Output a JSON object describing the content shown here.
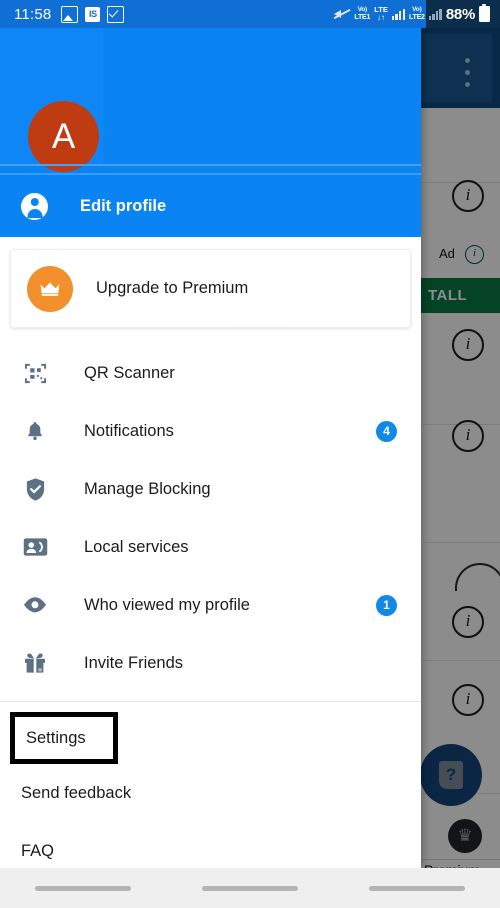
{
  "statusbar": {
    "time": "11:58",
    "left_icons": [
      "photo-icon",
      "is-badge-icon",
      "checkbox-icon"
    ],
    "is_badge_text": "IS",
    "mute_icon": "volume-mute-icon",
    "sim1": {
      "volte": "Vo)",
      "volte_sub": "LTE1",
      "tech": "LTE",
      "arrows": "↓↑"
    },
    "sim2": {
      "volte": "Vo)",
      "volte_sub": "LTE2"
    },
    "battery_text": "88%",
    "battery_icon": "battery-full-icon"
  },
  "drawer": {
    "avatar_initial": "A",
    "avatar_color": "#bf3c12",
    "header_color": "#0b84f3",
    "edit_profile": {
      "label": "Edit profile",
      "icon": "account-circle-icon"
    },
    "premium_card": {
      "label": "Upgrade to Premium",
      "icon": "crown-icon",
      "badge_color": "#f2902d"
    },
    "menu_items": [
      {
        "label": "QR Scanner",
        "icon": "qr-code-icon",
        "badge": ""
      },
      {
        "label": "Notifications",
        "icon": "bell-icon",
        "badge": "4"
      },
      {
        "label": "Manage Blocking",
        "icon": "shield-check-icon",
        "badge": ""
      },
      {
        "label": "Local services",
        "icon": "contact-card-icon",
        "badge": ""
      },
      {
        "label": "Who viewed my profile",
        "icon": "eye-icon",
        "badge": "1"
      },
      {
        "label": "Invite Friends",
        "icon": "gift-icon",
        "badge": ""
      }
    ],
    "footer_items": [
      {
        "label": "Settings",
        "highlighted": true
      },
      {
        "label": "Send feedback",
        "highlighted": false
      },
      {
        "label": "FAQ",
        "highlighted": false
      }
    ],
    "badge_color": "#1288e8"
  },
  "background": {
    "kebab_icon": "more-vertical-icon",
    "ad_label": "Ad",
    "ad_info_icon": "info-icon",
    "install_button": "TALL",
    "help_fab_icon": "help-question-icon",
    "premium_tab_icon": "crown-icon",
    "premium_tab_label": "Premium",
    "info_icon": "info-icon"
  },
  "navbar": {
    "pills": [
      "recents-pill",
      "home-pill",
      "back-pill"
    ]
  }
}
